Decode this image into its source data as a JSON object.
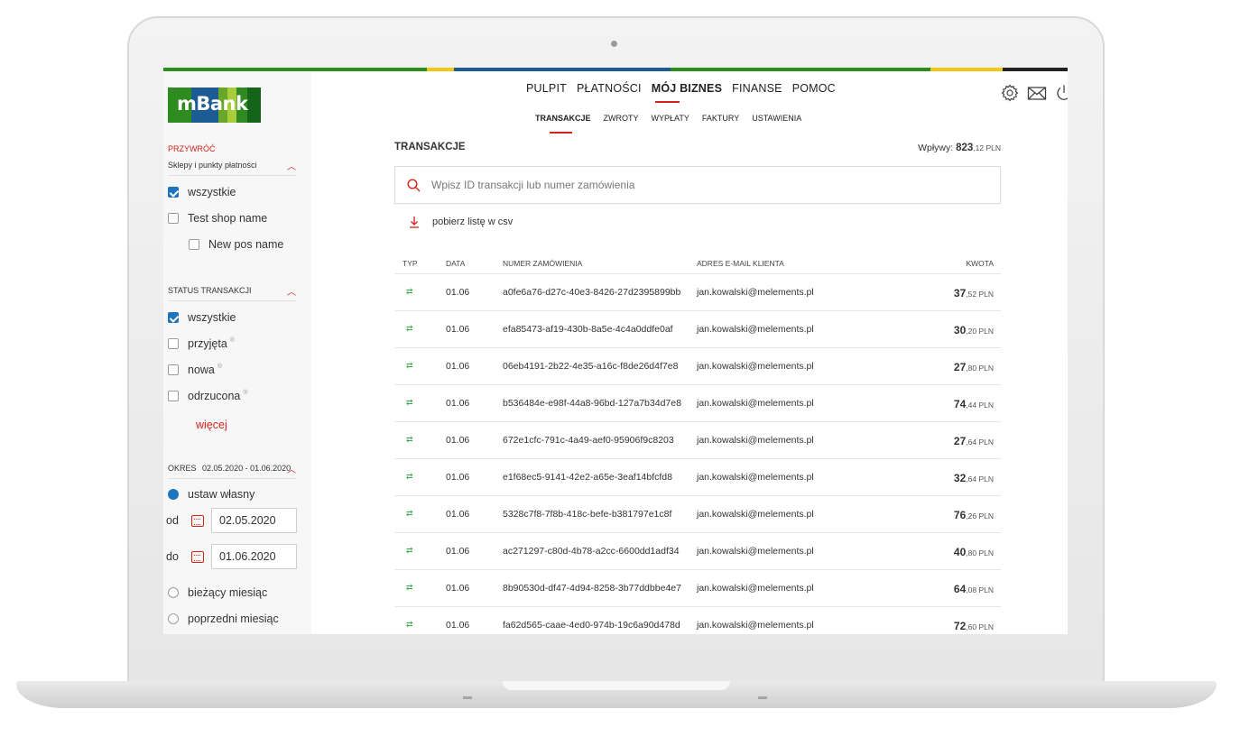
{
  "colors": {
    "accent": "#d2231b",
    "brand_green": "#2e8b1f",
    "checkbox_blue": "#1d75bd",
    "top_stripe": [
      "#2e8b1f",
      "#f2c811",
      "#1d5b94",
      "#2e8b1f",
      "#f2c811",
      "#222222"
    ]
  },
  "logo": {
    "text": "mBank"
  },
  "nav": {
    "main": [
      "PULPIT",
      "PŁATNOŚCI",
      "MÓJ BIZNES",
      "FINANSE",
      "POMOC"
    ],
    "main_active": "MÓJ BIZNES",
    "sub": [
      "TRANSAKCJE",
      "ZWROTY",
      "WYPŁATY",
      "FAKTURY",
      "USTAWIENIA"
    ],
    "sub_active": "TRANSAKCJE",
    "icons": [
      "gear-icon",
      "envelope-icon",
      "power-icon"
    ]
  },
  "sidebar": {
    "restore_label": "PRZYWRÓĆ",
    "shops": {
      "title": "Sklepy i punkty płatności",
      "options": [
        {
          "label": "wszystkie",
          "checked": true
        },
        {
          "label": "Test shop name",
          "checked": false
        },
        {
          "label": "New pos name",
          "checked": false
        }
      ]
    },
    "status": {
      "title": "STATUS TRANSAKCJI",
      "options": [
        {
          "label": "wszystkie",
          "checked": true
        },
        {
          "label": "przyjęta",
          "checked": false
        },
        {
          "label": "nowa",
          "checked": false
        },
        {
          "label": "odrzucona",
          "checked": false
        }
      ],
      "info_glyph": "®",
      "more_label": "więcej"
    },
    "period": {
      "title": "OKRES",
      "range": "02.05.2020 - 01.06.2020",
      "custom_label": "ustaw własny",
      "from_label": "od",
      "from_value": "02.05.2020",
      "to_label": "do",
      "to_value": "01.06.2020",
      "current_month_label": "bieżący miesiąc",
      "previous_month_label": "poprzedni miesiąc"
    }
  },
  "main": {
    "title": "TRANSAKCJE",
    "inflow_label": "Wpływy:",
    "inflow_int": "823",
    "inflow_dec": ",12 PLN",
    "search_placeholder": "Wpisz ID transakcji lub numer zamówienia",
    "csv_label": "pobierz listę w csv",
    "columns": [
      "TYP",
      "DATA",
      "NUMER ZAMÓWIENIA",
      "ADRES E-MAIL KLIENTA",
      "KWOTA"
    ],
    "rows": [
      {
        "type": "⇄",
        "date": "01.06",
        "order": "a0fe6a76-d27c-40e3-8426-27d2395899bb",
        "email": "jan.kowalski@melements.pl",
        "amount_int": "37",
        "amount_dec": ",52 PLN"
      },
      {
        "type": "⇄",
        "date": "01.06",
        "order": "efa85473-af19-430b-8a5e-4c4a0ddfe0af",
        "email": "jan.kowalski@melements.pl",
        "amount_int": "30",
        "amount_dec": ",20 PLN"
      },
      {
        "type": "⇄",
        "date": "01.06",
        "order": "06eb4191-2b22-4e35-a16c-f8de26d4f7e8",
        "email": "jan.kowalski@melements.pl",
        "amount_int": "27",
        "amount_dec": ",80 PLN"
      },
      {
        "type": "⇄",
        "date": "01.06",
        "order": "b536484e-e98f-44a8-96bd-127a7b34d7e8",
        "email": "jan.kowalski@melements.pl",
        "amount_int": "74",
        "amount_dec": ",44 PLN"
      },
      {
        "type": "⇄",
        "date": "01.06",
        "order": "672e1cfc-791c-4a49-aef0-95906f9c8203",
        "email": "jan.kowalski@melements.pl",
        "amount_int": "27",
        "amount_dec": ",64 PLN"
      },
      {
        "type": "⇄",
        "date": "01.06",
        "order": "e1f68ec5-9141-42e2-a65e-3eaf14bfcfd8",
        "email": "jan.kowalski@melements.pl",
        "amount_int": "32",
        "amount_dec": ",64 PLN"
      },
      {
        "type": "⇄",
        "date": "01.06",
        "order": "5328c7f8-7f8b-418c-befe-b381797e1c8f",
        "email": "jan.kowalski@melements.pl",
        "amount_int": "76",
        "amount_dec": ",26 PLN"
      },
      {
        "type": "⇄",
        "date": "01.06",
        "order": "ac271297-c80d-4b78-a2cc-6600dd1adf34",
        "email": "jan.kowalski@melements.pl",
        "amount_int": "40",
        "amount_dec": ",80 PLN"
      },
      {
        "type": "⇄",
        "date": "01.06",
        "order": "8b90530d-df47-4d94-8258-3b77ddbbe4e7",
        "email": "jan.kowalski@melements.pl",
        "amount_int": "64",
        "amount_dec": ",08 PLN"
      },
      {
        "type": "⇄",
        "date": "01.06",
        "order": "fa62d565-caae-4ed0-974b-19c6a90d478d",
        "email": "jan.kowalski@melements.pl",
        "amount_int": "72",
        "amount_dec": ",60 PLN"
      }
    ]
  }
}
